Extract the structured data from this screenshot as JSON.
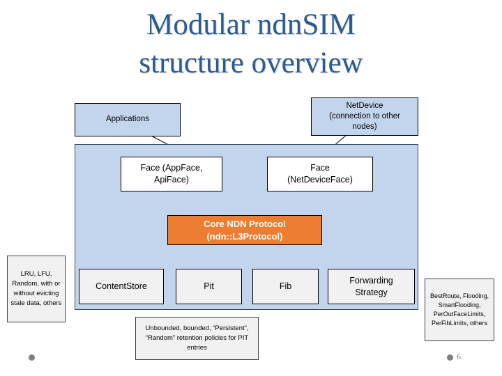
{
  "slide": {
    "title_line1": "Modular ndnSIM",
    "title_line2": "structure overview",
    "title_color": "#2e5a8e",
    "page_number": "6"
  },
  "diagram": {
    "applications": {
      "label": "Applications",
      "fill": "#c3d5ec"
    },
    "netdevice": {
      "label": "NetDevice\n(connection to other\nnodes)",
      "line1": "NetDevice",
      "line2": "(connection to other",
      "line3": "nodes)",
      "fill": "#c3d5ec"
    },
    "face_app": {
      "line1": "Face (AppFace,",
      "line2": "ApiFace)",
      "fill": "#ffffff"
    },
    "face_netdevice": {
      "line1": "Face",
      "line2": "(NetDeviceFace)",
      "fill": "#ffffff"
    },
    "core": {
      "line1": "Core NDN Protocol",
      "line2": "(ndn::L3Protocol)",
      "fill": "#ed7d31",
      "text_color": "#ffffff"
    },
    "modules": [
      {
        "label": "ContentStore",
        "fill": "#f1f1f1"
      },
      {
        "label": "Pit",
        "fill": "#f1f1f1"
      },
      {
        "label": "Fib",
        "fill": "#f1f1f1"
      },
      {
        "line1": "Forwarding",
        "line2": "Strategy",
        "fill": "#f1f1f1"
      }
    ],
    "notes": {
      "content_store_policies": "LRU, LFU, Random, with or without evicting stale data, others",
      "pit_policies": "Unbounded, bounded, “Persistent”, “Random” retention policies for PIT entries",
      "strategy_list": "BestRoute, Flooding, SmartFlooding, PerOutFaceLimits, PerFibLimits, others"
    }
  }
}
